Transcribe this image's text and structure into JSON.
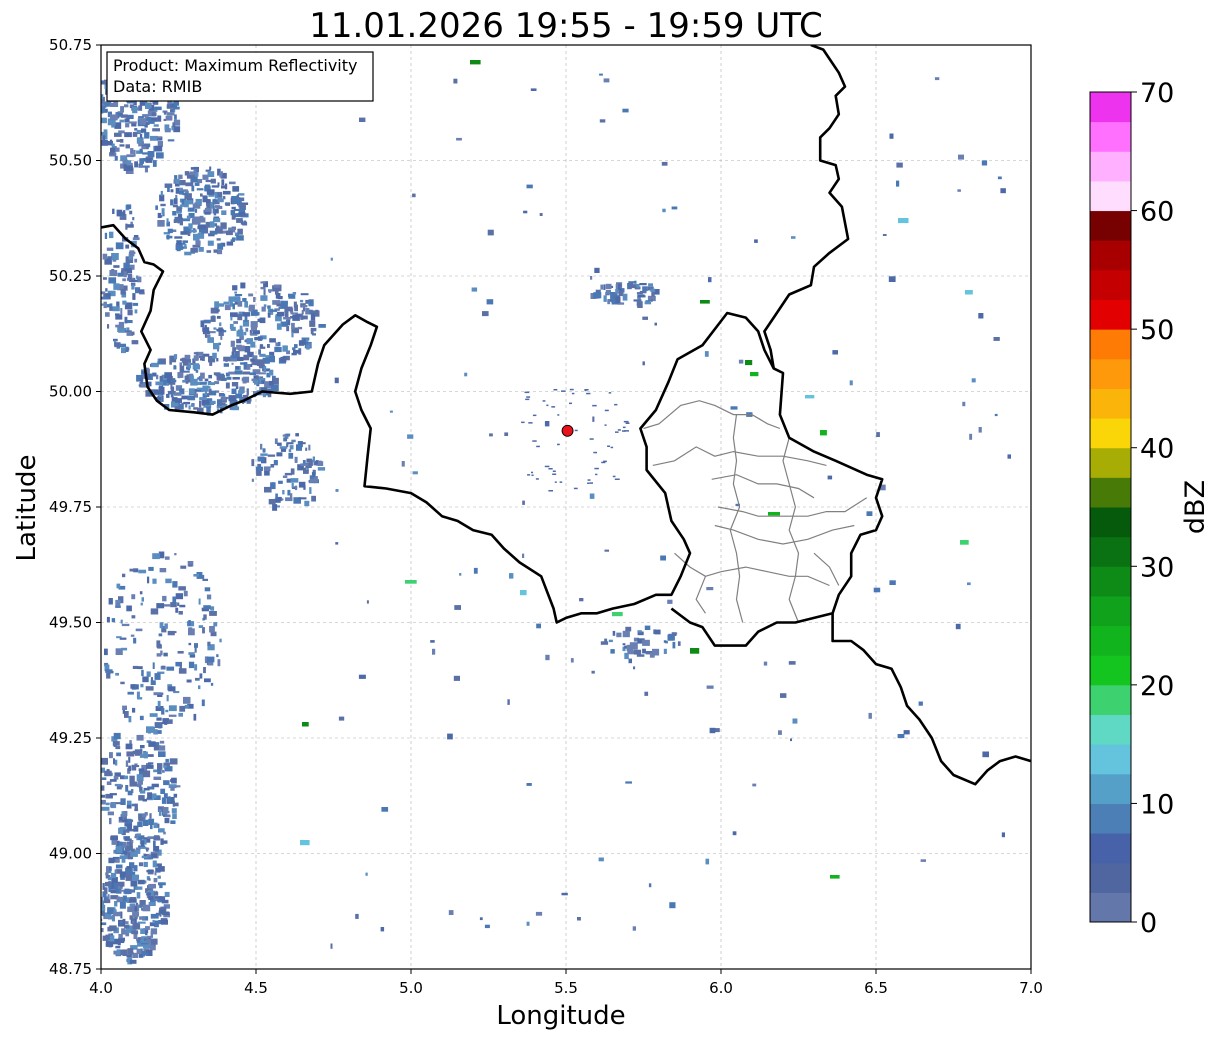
{
  "title": "11.01.2026 19:55 - 19:59 UTC",
  "xlabel": "Longitude",
  "ylabel": "Latitude",
  "info_box": {
    "product": "Product: Maximum Reflectivity",
    "data": "Data: RMIB"
  },
  "colorbar": {
    "label": "dBZ",
    "min": 0,
    "max": 70,
    "ticks": [
      0,
      10,
      20,
      30,
      40,
      50,
      60,
      70
    ],
    "tick_labels": [
      "0",
      "10",
      "20",
      "30",
      "40",
      "50",
      "60",
      "70"
    ],
    "colors": [
      "#6477aa",
      "#4f66a1",
      "#4762a8",
      "#4c7fb6",
      "#55a0c9",
      "#64c3dd",
      "#5fd8c4",
      "#3dd26f",
      "#15c51f",
      "#12b41d",
      "#10a21a",
      "#0e8a16",
      "#0a7212",
      "#055a0c",
      "#487a08",
      "#a8ad05",
      "#fad608",
      "#fbb409",
      "#fd990a",
      "#fe7b06",
      "#e20000",
      "#c40000",
      "#a80000",
      "#770000",
      "#ffddff",
      "#ffb0ff",
      "#ff70ff",
      "#ee33ee"
    ]
  },
  "map": {
    "xlim": [
      4.0,
      7.0
    ],
    "ylim": [
      48.75,
      50.75
    ],
    "x_ticks": [
      4.0,
      4.5,
      5.0,
      5.5,
      6.0,
      6.5,
      7.0
    ],
    "x_tick_labels": [
      "4.0",
      "4.5",
      "5.0",
      "5.5",
      "6.0",
      "6.5",
      "7.0"
    ],
    "y_ticks": [
      48.75,
      49.0,
      49.25,
      49.5,
      49.75,
      50.0,
      50.25,
      50.5,
      50.75
    ],
    "y_tick_labels": [
      "48.75",
      "49.00",
      "49.25",
      "49.50",
      "49.75",
      "50.00",
      "50.25",
      "50.50",
      "50.75"
    ],
    "grid": true,
    "radar_site": {
      "lon": 5.505,
      "lat": 49.915,
      "color": "#e8131b"
    },
    "borders": [
      [
        [
          4.0,
          50.355
        ],
        [
          4.04,
          50.36
        ],
        [
          4.08,
          50.33
        ],
        [
          4.12,
          50.31
        ],
        [
          4.14,
          50.28
        ],
        [
          4.17,
          50.275
        ],
        [
          4.2,
          50.26
        ],
        [
          4.17,
          50.22
        ],
        [
          4.16,
          50.175
        ],
        [
          4.13,
          50.13
        ],
        [
          4.16,
          50.09
        ],
        [
          4.14,
          50.06
        ],
        [
          4.15,
          50.01
        ],
        [
          4.18,
          49.98
        ],
        [
          4.22,
          49.96
        ],
        [
          4.3,
          49.955
        ],
        [
          4.36,
          49.95
        ],
        [
          4.42,
          49.97
        ],
        [
          4.46,
          49.98
        ],
        [
          4.52,
          50.0
        ],
        [
          4.61,
          49.995
        ],
        [
          4.68,
          50.0
        ],
        [
          4.7,
          50.06
        ],
        [
          4.72,
          50.1
        ],
        [
          4.78,
          50.145
        ],
        [
          4.82,
          50.165
        ],
        [
          4.86,
          50.15
        ],
        [
          4.89,
          50.14
        ],
        [
          4.87,
          50.1
        ],
        [
          4.84,
          50.05
        ],
        [
          4.82,
          50.0
        ],
        [
          4.84,
          49.96
        ],
        [
          4.87,
          49.92
        ],
        [
          4.86,
          49.86
        ],
        [
          4.85,
          49.795
        ],
        [
          4.92,
          49.79
        ],
        [
          5.0,
          49.78
        ],
        [
          5.05,
          49.76
        ],
        [
          5.1,
          49.73
        ],
        [
          5.15,
          49.72
        ],
        [
          5.2,
          49.7
        ],
        [
          5.26,
          49.69
        ],
        [
          5.3,
          49.66
        ],
        [
          5.35,
          49.63
        ],
        [
          5.42,
          49.6
        ],
        [
          5.46,
          49.53
        ],
        [
          5.47,
          49.5
        ],
        [
          5.5,
          49.51
        ],
        [
          5.55,
          49.52
        ],
        [
          5.6,
          49.52
        ],
        [
          5.65,
          49.53
        ],
        [
          5.72,
          49.54
        ],
        [
          5.79,
          49.56
        ],
        [
          5.84,
          49.56
        ],
        [
          5.87,
          49.6
        ],
        [
          5.9,
          49.65
        ],
        [
          5.88,
          49.68
        ],
        [
          5.84,
          49.72
        ],
        [
          5.82,
          49.78
        ],
        [
          5.76,
          49.83
        ],
        [
          5.76,
          49.88
        ],
        [
          5.74,
          49.92
        ],
        [
          5.79,
          49.96
        ],
        [
          5.83,
          50.02
        ],
        [
          5.86,
          50.07
        ],
        [
          5.94,
          50.1
        ],
        [
          6.02,
          50.17
        ],
        [
          6.08,
          50.16
        ],
        [
          6.12,
          50.13
        ],
        [
          6.14,
          50.09
        ],
        [
          6.17,
          50.05
        ],
        [
          6.2,
          50.04
        ],
        [
          6.19,
          49.95
        ],
        [
          6.22,
          49.9
        ],
        [
          6.3,
          49.87
        ],
        [
          6.37,
          49.85
        ],
        [
          6.47,
          49.82
        ],
        [
          6.52,
          49.81
        ],
        [
          6.5,
          49.77
        ],
        [
          6.52,
          49.73
        ],
        [
          6.5,
          49.7
        ],
        [
          6.45,
          49.69
        ],
        [
          6.42,
          49.65
        ],
        [
          6.42,
          49.6
        ],
        [
          6.38,
          49.56
        ],
        [
          6.36,
          49.52
        ],
        [
          6.3,
          49.51
        ],
        [
          6.24,
          49.5
        ],
        [
          6.18,
          49.5
        ],
        [
          6.12,
          49.48
        ],
        [
          6.08,
          49.45
        ],
        [
          6.02,
          49.45
        ],
        [
          5.98,
          49.45
        ],
        [
          5.94,
          49.49
        ],
        [
          5.9,
          49.5
        ],
        [
          5.84,
          49.53
        ]
      ],
      [
        [
          6.29,
          50.75
        ],
        [
          6.33,
          50.74
        ],
        [
          6.35,
          50.72
        ],
        [
          6.38,
          50.69
        ],
        [
          6.4,
          50.66
        ],
        [
          6.37,
          50.64
        ],
        [
          6.38,
          50.6
        ],
        [
          6.35,
          50.57
        ],
        [
          6.32,
          50.55
        ],
        [
          6.32,
          50.5
        ],
        [
          6.37,
          50.49
        ],
        [
          6.38,
          50.46
        ],
        [
          6.35,
          50.43
        ],
        [
          6.39,
          50.4
        ],
        [
          6.41,
          50.33
        ],
        [
          6.35,
          50.3
        ],
        [
          6.3,
          50.27
        ],
        [
          6.29,
          50.23
        ],
        [
          6.22,
          50.21
        ],
        [
          6.17,
          50.16
        ],
        [
          6.14,
          50.13
        ],
        [
          6.16,
          50.09
        ],
        [
          6.17,
          50.05
        ]
      ],
      [
        [
          6.36,
          49.52
        ],
        [
          6.36,
          49.46
        ],
        [
          6.42,
          49.46
        ],
        [
          6.46,
          49.44
        ],
        [
          6.5,
          49.41
        ],
        [
          6.55,
          49.4
        ],
        [
          6.58,
          49.36
        ],
        [
          6.6,
          49.32
        ],
        [
          6.64,
          49.29
        ],
        [
          6.68,
          49.25
        ],
        [
          6.71,
          49.2
        ],
        [
          6.75,
          49.17
        ],
        [
          6.82,
          49.15
        ],
        [
          6.86,
          49.18
        ],
        [
          6.9,
          49.2
        ],
        [
          6.95,
          49.21
        ],
        [
          7.0,
          49.2
        ]
      ]
    ],
    "regional_lines": [
      [
        [
          5.75,
          49.92
        ],
        [
          5.8,
          49.93
        ],
        [
          5.87,
          49.97
        ],
        [
          5.93,
          49.98
        ],
        [
          5.98,
          49.97
        ],
        [
          6.04,
          49.95
        ],
        [
          6.1,
          49.95
        ],
        [
          6.15,
          49.93
        ],
        [
          6.19,
          49.92
        ]
      ],
      [
        [
          5.78,
          49.84
        ],
        [
          5.85,
          49.85
        ],
        [
          5.92,
          49.88
        ],
        [
          5.98,
          49.86
        ],
        [
          6.04,
          49.87
        ],
        [
          6.12,
          49.86
        ],
        [
          6.2,
          49.86
        ],
        [
          6.28,
          49.85
        ],
        [
          6.34,
          49.84
        ]
      ],
      [
        [
          5.97,
          49.81
        ],
        [
          6.05,
          49.82
        ],
        [
          6.12,
          49.8
        ],
        [
          6.18,
          49.8
        ],
        [
          6.25,
          49.79
        ],
        [
          6.3,
          49.77
        ]
      ],
      [
        [
          5.99,
          49.75
        ],
        [
          6.07,
          49.74
        ],
        [
          6.12,
          49.73
        ],
        [
          6.2,
          49.73
        ],
        [
          6.28,
          49.73
        ],
        [
          6.34,
          49.74
        ],
        [
          6.4,
          49.74
        ],
        [
          6.47,
          49.77
        ]
      ],
      [
        [
          5.98,
          49.71
        ],
        [
          6.04,
          49.7
        ],
        [
          6.12,
          49.68
        ],
        [
          6.2,
          49.67
        ],
        [
          6.28,
          49.68
        ],
        [
          6.36,
          49.7
        ],
        [
          6.43,
          49.71
        ]
      ],
      [
        [
          5.95,
          49.6
        ],
        [
          6.0,
          49.61
        ],
        [
          6.08,
          49.62
        ],
        [
          6.15,
          49.61
        ],
        [
          6.22,
          49.6
        ],
        [
          6.28,
          49.6
        ],
        [
          6.35,
          49.58
        ]
      ],
      [
        [
          6.05,
          49.95
        ],
        [
          6.04,
          49.9
        ],
        [
          6.05,
          49.85
        ],
        [
          6.04,
          49.8
        ],
        [
          6.06,
          49.75
        ],
        [
          6.03,
          49.7
        ],
        [
          6.05,
          49.65
        ],
        [
          6.06,
          49.6
        ],
        [
          6.05,
          49.55
        ],
        [
          6.07,
          49.5
        ]
      ],
      [
        [
          6.22,
          49.9
        ],
        [
          6.2,
          49.85
        ],
        [
          6.22,
          49.8
        ],
        [
          6.24,
          49.75
        ],
        [
          6.22,
          49.7
        ],
        [
          6.25,
          49.65
        ],
        [
          6.24,
          49.6
        ],
        [
          6.22,
          49.55
        ],
        [
          6.25,
          49.5
        ]
      ],
      [
        [
          5.85,
          49.65
        ],
        [
          5.9,
          49.62
        ],
        [
          5.95,
          49.6
        ],
        [
          5.92,
          49.55
        ],
        [
          5.95,
          49.52
        ]
      ],
      [
        [
          6.3,
          49.65
        ],
        [
          6.35,
          49.62
        ],
        [
          6.38,
          49.58
        ]
      ]
    ]
  }
}
